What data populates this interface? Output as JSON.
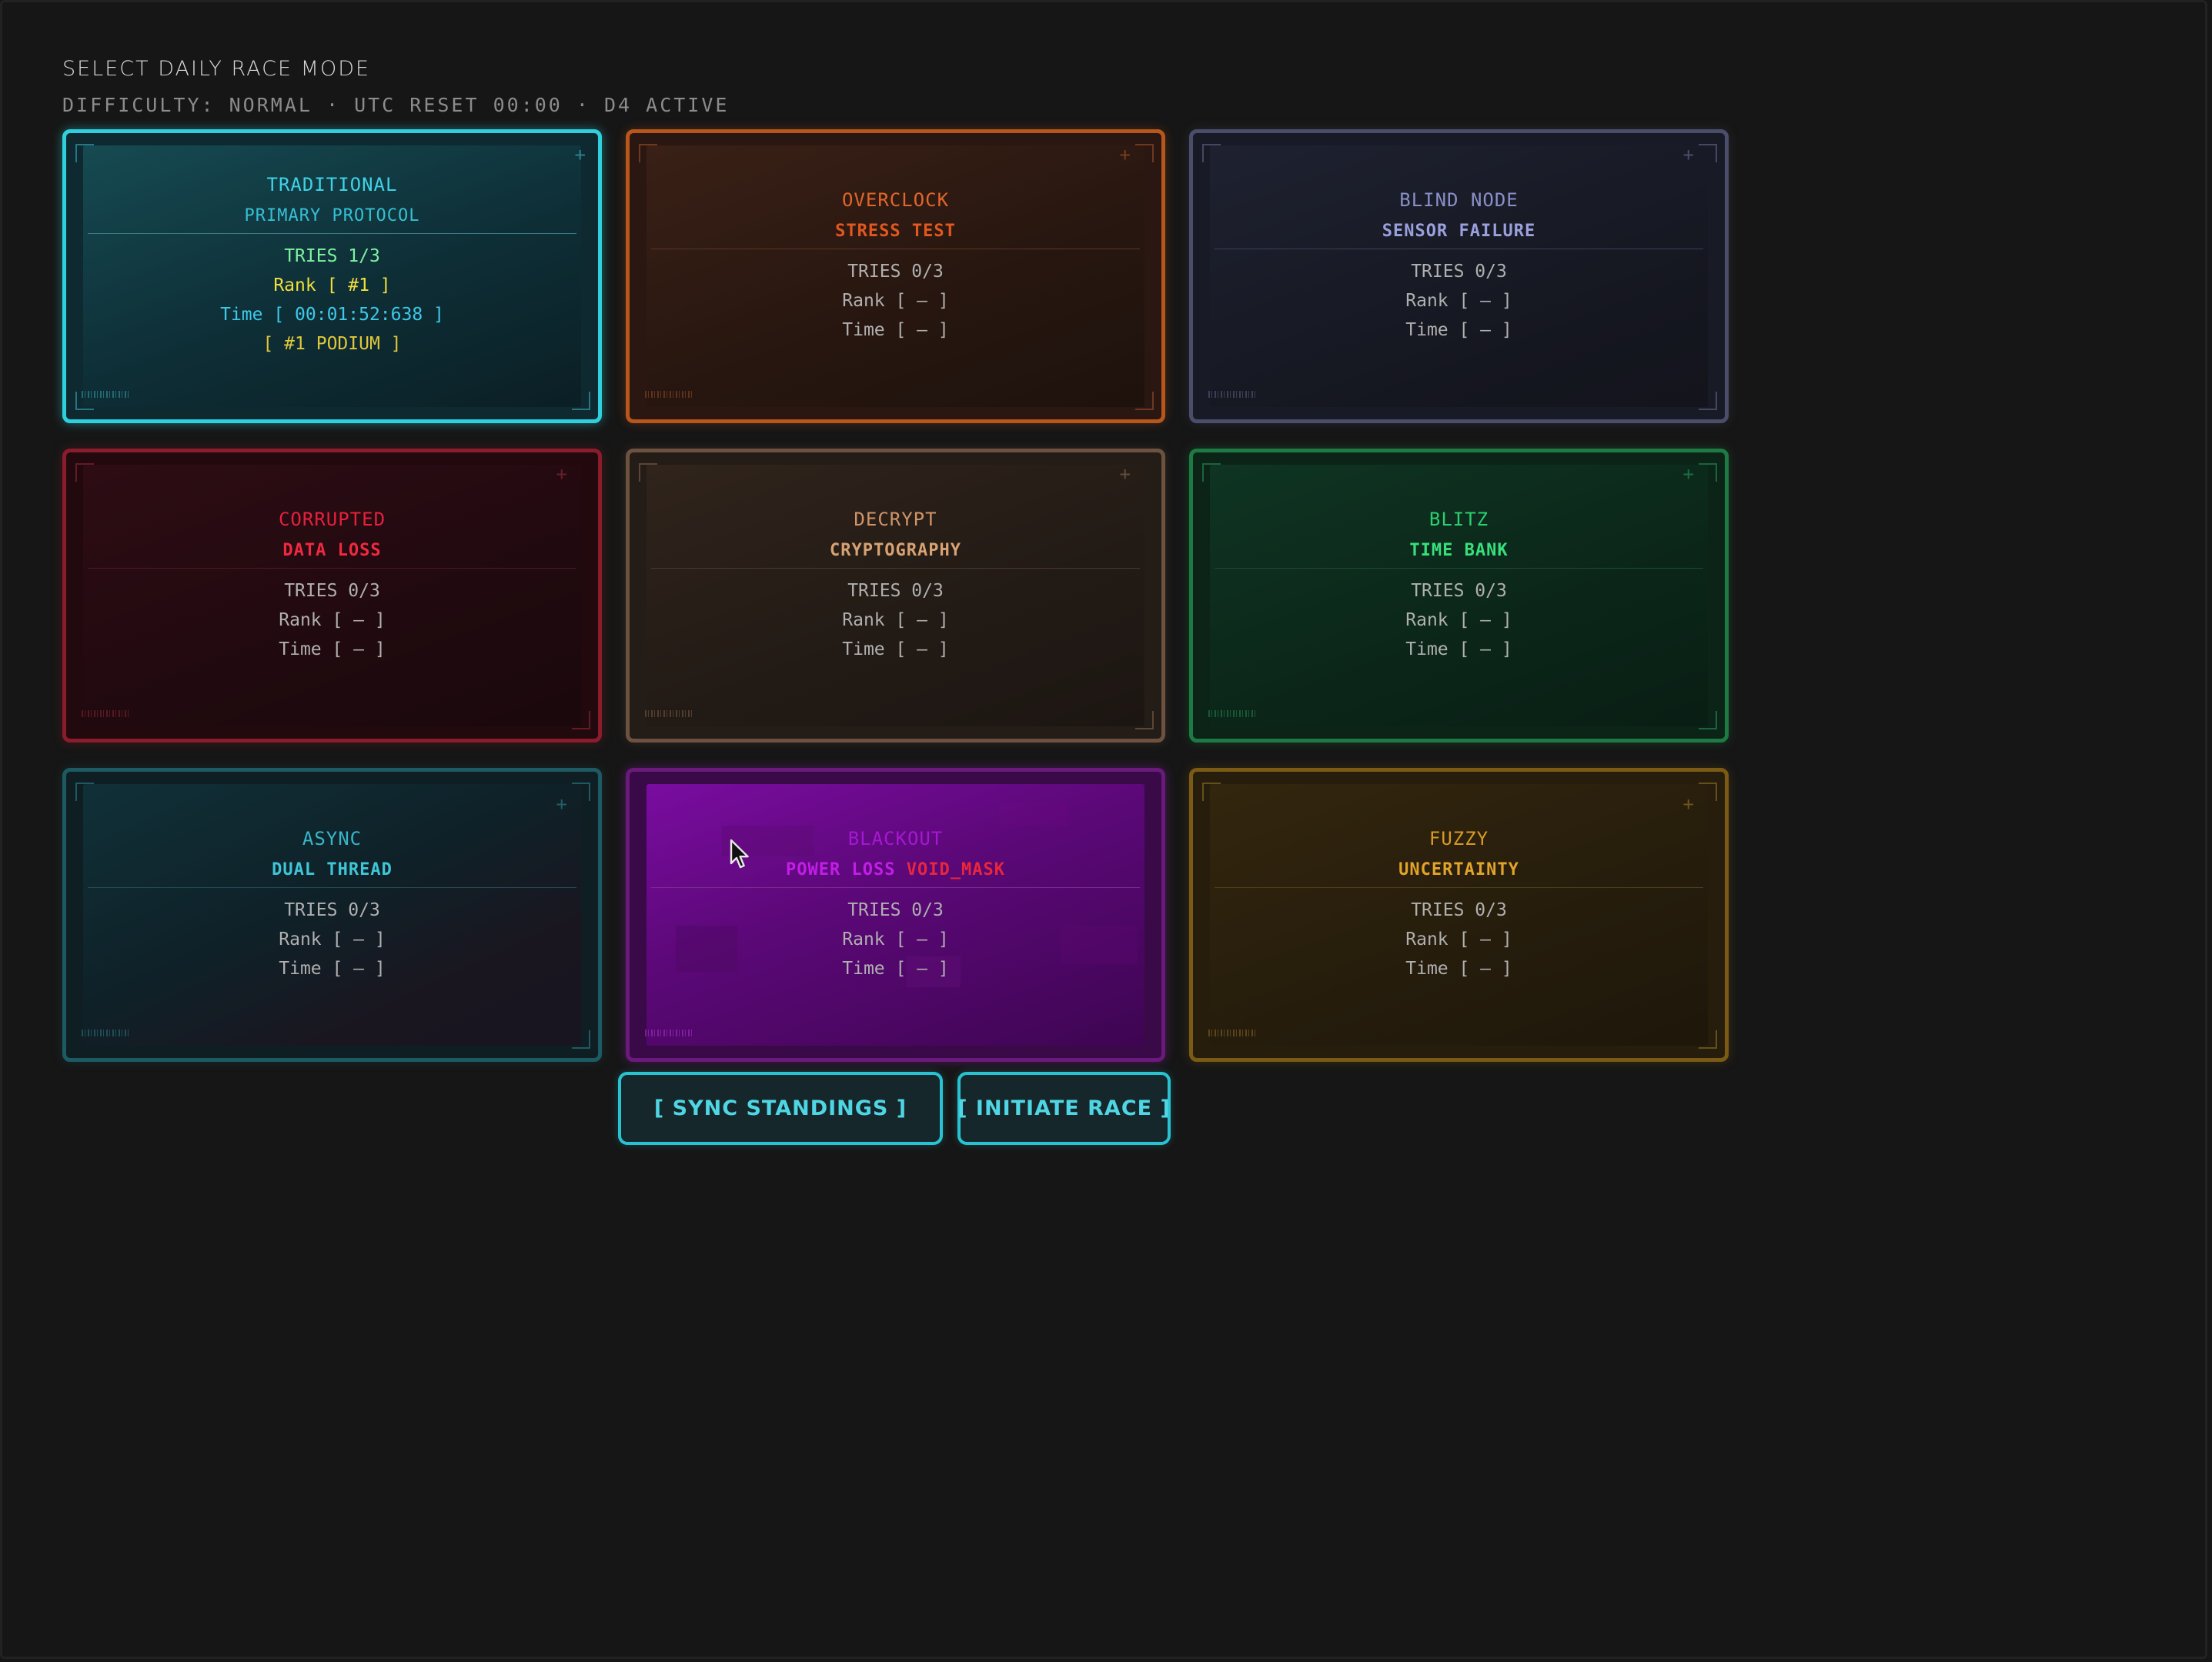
{
  "header": {
    "title": "SELECT DAILY RACE MODE",
    "subtitle": "DIFFICULTY: NORMAL · UTC RESET 00:00 · D4 ACTIVE"
  },
  "modes": [
    {
      "title": "TRADITIONAL",
      "subtitle": "PRIMARY PROTOCOL",
      "tries": "TRIES 1/3",
      "rank": "Rank [ #1 ]",
      "time": "Time [ 00:01:52:638 ]",
      "podium": "[ #1 PODIUM ]",
      "accent": "#2fc9d8"
    },
    {
      "title": "OVERCLOCK",
      "subtitle": "STRESS TEST",
      "tries": "TRIES 0/3",
      "rank": "Rank [ – ]",
      "time": "Time [ – ]",
      "accent": "#d9661e"
    },
    {
      "title": "BLIND NODE",
      "subtitle": "SENSOR FAILURE",
      "tries": "TRIES 0/3",
      "rank": "Rank [ – ]",
      "time": "Time [ – ]",
      "accent": "#7d86c4"
    },
    {
      "title": "CORRUPTED",
      "subtitle": "DATA LOSS",
      "tries": "TRIES 0/3",
      "rank": "Rank [ – ]",
      "time": "Time [ – ]",
      "accent": "#e0243a"
    },
    {
      "title": "DECRYPT",
      "subtitle": "CRYPTOGRAPHY",
      "tries": "TRIES 0/3",
      "rank": "Rank [ – ]",
      "time": "Time [ – ]",
      "accent": "#d29a6a"
    },
    {
      "title": "BLITZ",
      "subtitle": "TIME BANK",
      "tries": "TRIES 0/3",
      "rank": "Rank [ – ]",
      "time": "Time [ – ]",
      "accent": "#28c86a"
    },
    {
      "title": "ASYNC",
      "subtitle": "DUAL THREAD",
      "tries": "TRIES 0/3",
      "rank": "Rank [ – ]",
      "time": "Time [ – ]",
      "accent": "#2fb8cc"
    },
    {
      "title": "BLACKOUT",
      "subtitle": "POWER LOSS",
      "subtitle_extra": "VOID_MASK",
      "tries": "TRIES 0/3",
      "rank": "Rank [ – ]",
      "time": "Time [ – ]",
      "accent": "#b81ee0"
    },
    {
      "title": "FUZZY",
      "subtitle": "UNCERTAINTY",
      "tries": "TRIES 0/3",
      "rank": "Rank [ – ]",
      "time": "Time [ – ]",
      "accent": "#e0a21e"
    }
  ],
  "actions": {
    "sync_label": "[ SYNC STANDINGS ]",
    "initiate_label": "[ INITIATE RACE ]"
  }
}
